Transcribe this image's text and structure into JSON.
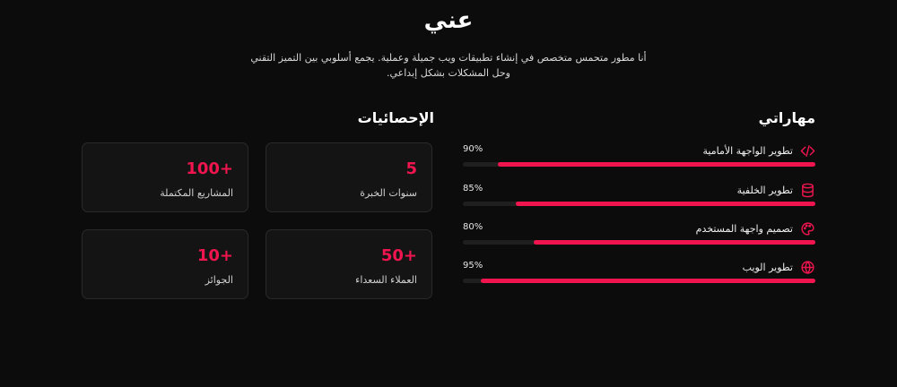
{
  "about": {
    "title": "عني",
    "description": "أنا مطور متحمس متخصص في إنشاء تطبيقات ويب جميلة وعملية. يجمع أسلوبي بين التميز التقني وحل المشكلات بشكل إبداعي."
  },
  "skills": {
    "title": "مهاراتي",
    "items": [
      {
        "label": "تطوير الواجهة الأمامية",
        "percent": "90%",
        "level": 90,
        "icon": "code-icon"
      },
      {
        "label": "تطوير الخلفية",
        "percent": "85%",
        "level": 85,
        "icon": "database-icon"
      },
      {
        "label": "تصميم واجهة المستخدم",
        "percent": "80%",
        "level": 80,
        "icon": "palette-icon"
      },
      {
        "label": "تطوير الويب",
        "percent": "95%",
        "level": 95,
        "icon": "globe-icon"
      }
    ]
  },
  "stats": {
    "title": "الإحصائيات",
    "items": [
      {
        "value": "5",
        "label": "سنوات الخبرة"
      },
      {
        "value": "+100",
        "label": "المشاريع المكتملة"
      },
      {
        "value": "+50",
        "label": "العملاء السعداء"
      },
      {
        "value": "+10",
        "label": "الجوائز"
      }
    ]
  },
  "colors": {
    "accent": "#f0154f",
    "background": "#0c0c0c",
    "card": "#141414"
  }
}
